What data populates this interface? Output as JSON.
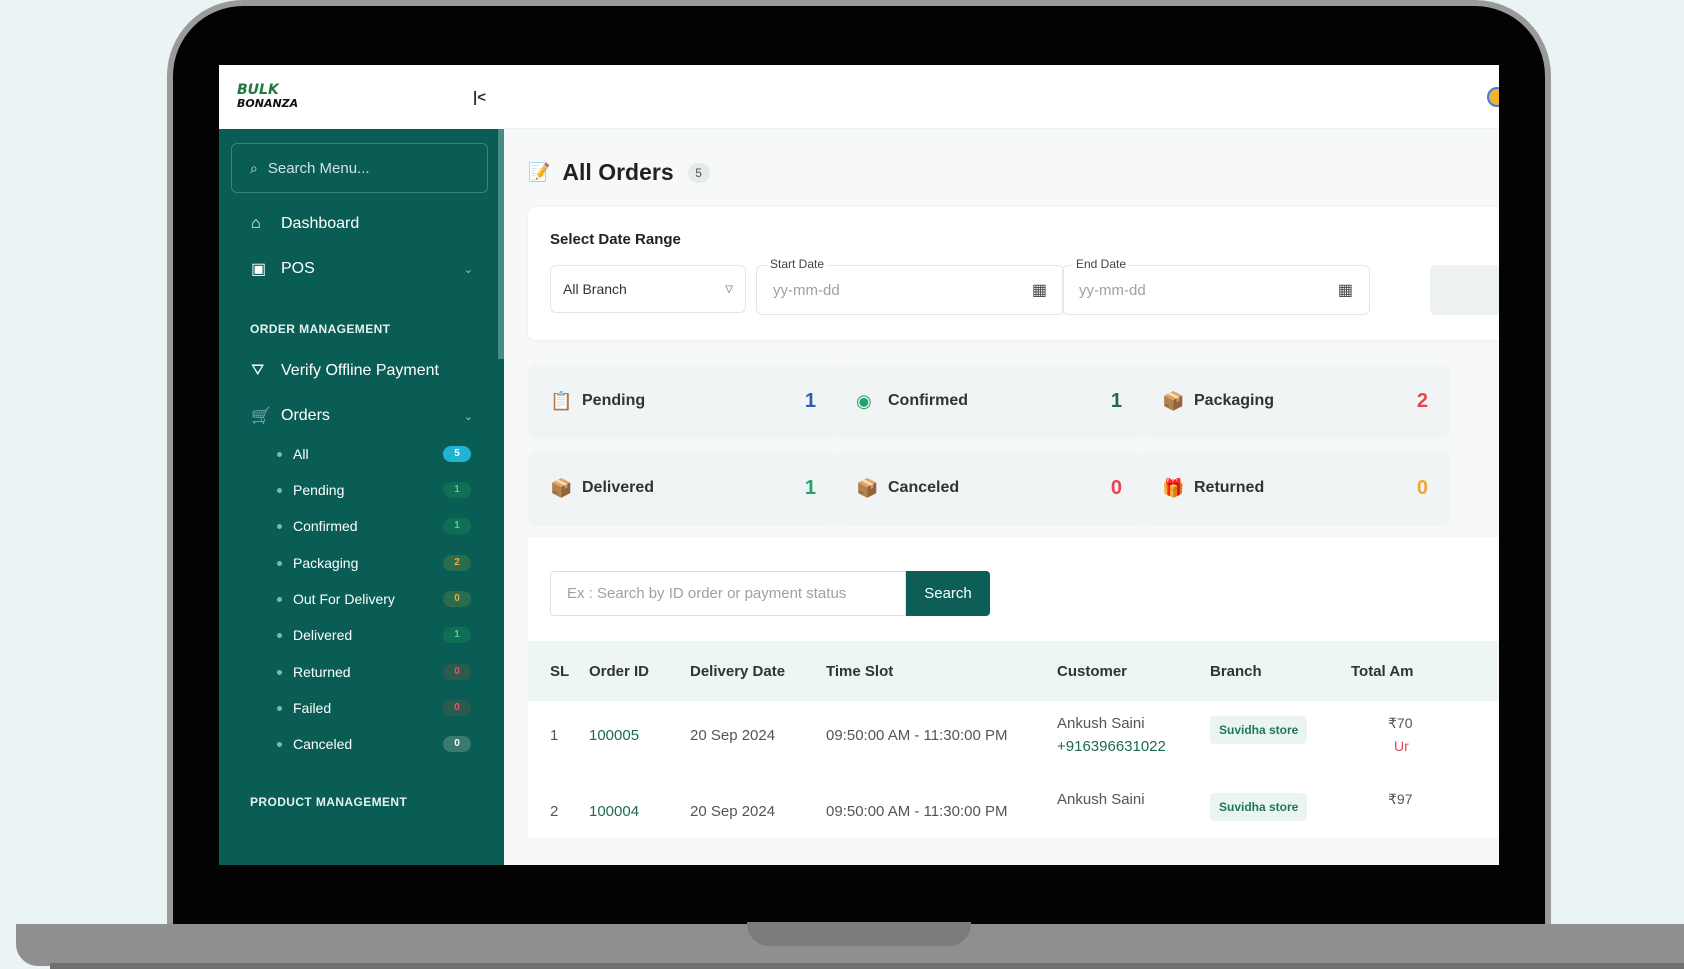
{
  "brand": {
    "line1": "BULK",
    "line2": "BONANZA"
  },
  "sidebar": {
    "search_placeholder": "Search Menu...",
    "dashboard": "Dashboard",
    "pos": "POS",
    "section_order": "ORDER MANAGEMENT",
    "verify": "Verify Offline Payment",
    "orders": "Orders",
    "sub": [
      {
        "label": "All",
        "count": "5"
      },
      {
        "label": "Pending",
        "count": "1"
      },
      {
        "label": "Confirmed",
        "count": "1"
      },
      {
        "label": "Packaging",
        "count": "2"
      },
      {
        "label": "Out For Delivery",
        "count": "0"
      },
      {
        "label": "Delivered",
        "count": "1"
      },
      {
        "label": "Returned",
        "count": "0"
      },
      {
        "label": "Failed",
        "count": "0"
      },
      {
        "label": "Canceled",
        "count": "0"
      }
    ],
    "section_product": "PRODUCT MANAGEMENT"
  },
  "page": {
    "title": "All Orders",
    "count": "5"
  },
  "date_range": {
    "label": "Select Date Range",
    "branch": "All Branch",
    "start_label": "Start Date",
    "start_placeholder": "yy-mm-dd",
    "end_label": "End Date",
    "end_placeholder": "yy-mm-dd"
  },
  "stats": [
    {
      "label": "Pending",
      "value": "1",
      "color": "#2c5fb4"
    },
    {
      "label": "Confirmed",
      "value": "1",
      "color": "#1d6b48"
    },
    {
      "label": "Packaging",
      "value": "2",
      "color": "#e84550"
    },
    {
      "label": "Delivered",
      "value": "1",
      "color": "#22a36a"
    },
    {
      "label": "Canceled",
      "value": "0",
      "color": "#e84550"
    },
    {
      "label": "Returned",
      "value": "0",
      "color": "#f2a33a"
    }
  ],
  "table": {
    "search_placeholder": "Ex : Search by ID  order or payment status",
    "search_button": "Search",
    "headers": [
      "SL",
      "Order ID",
      "Delivery Date",
      "Time Slot",
      "Customer",
      "Branch",
      "Total Am"
    ],
    "rows": [
      {
        "sl": "1",
        "order_id": "100005",
        "date": "20 Sep 2024",
        "slot": "09:50:00 AM - 11:30:00 PM",
        "customer": "Ankush Saini",
        "phone": "+916396631022",
        "branch": "Suvidha store",
        "total": "₹70",
        "status": "Ur"
      },
      {
        "sl": "2",
        "order_id": "100004",
        "date": "20 Sep 2024",
        "slot": "09:50:00 AM - 11:30:00 PM",
        "customer": "Ankush Saini",
        "phone": "",
        "branch": "Suvidha store",
        "total": "₹97",
        "status": ""
      }
    ]
  }
}
